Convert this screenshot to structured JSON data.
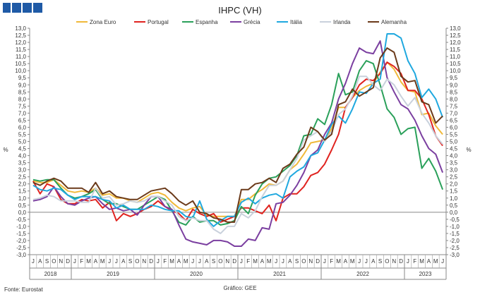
{
  "logo": {
    "color": "#1f5aa6"
  },
  "chart_data": {
    "type": "line",
    "title": "IHPC (VH)",
    "ylabel_left": "%",
    "ylabel_right": "%",
    "ylim": [
      -3.0,
      13.0
    ],
    "ytick_step": 0.5,
    "ytick_labels": [
      "13,0",
      "12,5",
      "12,0",
      "11,5",
      "11,0",
      "10,5",
      "10,0",
      "9,5",
      "9,0",
      "8,5",
      "8,0",
      "7,5",
      "7,0",
      "6,5",
      "6,0",
      "5,5",
      "5,0",
      "4,5",
      "4,0",
      "3,5",
      "3,0",
      "2,5",
      "2,0",
      "1,5",
      "1,0",
      "0,5",
      "0,0",
      "-0,5",
      "-1,0",
      "-1,5",
      "-2,0",
      "-2,5",
      "-3,0"
    ],
    "grid": false,
    "legend_position": "top",
    "source": "Fonte: Eurostat",
    "credit": "Gráfico: GEE",
    "x_months": [
      "J",
      "A",
      "S",
      "O",
      "N",
      "D",
      "J",
      "F",
      "M",
      "A",
      "M",
      "J",
      "J",
      "A",
      "S",
      "O",
      "N",
      "D",
      "J",
      "F",
      "M",
      "A",
      "M",
      "J",
      "J",
      "A",
      "S",
      "O",
      "N",
      "D",
      "J",
      "F",
      "M",
      "A",
      "M",
      "J",
      "J",
      "A",
      "S",
      "O",
      "N",
      "D",
      "J",
      "F",
      "M",
      "A",
      "M",
      "J",
      "J",
      "A",
      "S",
      "O",
      "N",
      "D",
      "J",
      "F",
      "M",
      "A",
      "M",
      "J"
    ],
    "years": [
      {
        "label": "2018",
        "start": 0,
        "end": 6
      },
      {
        "label": "2019",
        "start": 6,
        "end": 18
      },
      {
        "label": "2020",
        "start": 18,
        "end": 30
      },
      {
        "label": "2021",
        "start": 30,
        "end": 42
      },
      {
        "label": "2022",
        "start": 42,
        "end": 54
      },
      {
        "label": "2023",
        "start": 54,
        "end": 60
      }
    ],
    "series": [
      {
        "name": "Zona Euro",
        "color": "#f0b93a",
        "values": [
          2.2,
          2.1,
          2.1,
          2.3,
          1.9,
          1.5,
          1.4,
          1.5,
          1.4,
          1.7,
          1.2,
          1.3,
          1.0,
          1.0,
          0.8,
          0.7,
          1.0,
          1.3,
          1.4,
          1.2,
          0.7,
          0.3,
          0.1,
          0.3,
          0.4,
          -0.2,
          -0.3,
          -0.3,
          -0.3,
          -0.3,
          0.9,
          0.9,
          1.3,
          1.6,
          2.0,
          1.9,
          2.2,
          3.0,
          3.4,
          4.1,
          4.9,
          5.0,
          5.1,
          5.9,
          7.4,
          7.4,
          8.1,
          8.6,
          8.9,
          9.1,
          9.9,
          10.6,
          10.1,
          9.2,
          8.6,
          8.5,
          6.9,
          7.0,
          6.1,
          5.5
        ]
      },
      {
        "name": "Portugal",
        "color": "#e0231f",
        "values": [
          2.2,
          1.3,
          2.0,
          1.8,
          0.9,
          0.6,
          0.6,
          0.9,
          0.8,
          0.9,
          0.3,
          0.7,
          -0.6,
          -0.1,
          -0.3,
          -0.1,
          0.2,
          0.4,
          0.8,
          0.4,
          0.1,
          -0.1,
          -0.6,
          0.2,
          -0.1,
          -0.3,
          -0.1,
          -0.7,
          -0.5,
          -0.3,
          0.3,
          0.3,
          0.1,
          -0.1,
          0.5,
          -0.6,
          1.0,
          1.3,
          1.3,
          1.8,
          2.6,
          2.8,
          3.4,
          4.4,
          5.5,
          7.4,
          8.1,
          9.0,
          9.4,
          9.3,
          9.8,
          10.6,
          10.3,
          9.8,
          8.6,
          8.6,
          8.0,
          6.9,
          5.4,
          4.7
        ]
      },
      {
        "name": "Espanha",
        "color": "#2aa05a",
        "values": [
          2.3,
          2.2,
          2.3,
          2.3,
          1.7,
          1.2,
          1.0,
          1.1,
          1.3,
          1.6,
          0.9,
          0.6,
          0.6,
          0.4,
          0.2,
          0.2,
          0.5,
          0.8,
          1.1,
          0.9,
          0.1,
          -0.7,
          -0.9,
          -0.3,
          -0.7,
          -0.6,
          -0.6,
          -0.9,
          -0.8,
          -0.6,
          0.4,
          -0.1,
          1.2,
          2.0,
          2.4,
          2.5,
          2.9,
          3.3,
          4.0,
          5.4,
          5.5,
          6.6,
          6.2,
          7.6,
          9.8,
          8.3,
          8.5,
          10.0,
          10.7,
          10.5,
          9.0,
          7.3,
          6.7,
          5.5,
          5.9,
          6.0,
          3.1,
          3.8,
          2.9,
          1.6
        ]
      },
      {
        "name": "Grécia",
        "color": "#7b3fa0",
        "values": [
          0.8,
          0.9,
          1.1,
          1.8,
          1.1,
          0.6,
          0.5,
          0.8,
          1.0,
          1.1,
          0.6,
          0.2,
          0.3,
          0.1,
          0.2,
          -0.2,
          0.5,
          1.1,
          1.1,
          0.4,
          0.2,
          -0.9,
          -1.9,
          -2.1,
          -2.2,
          -2.3,
          -2.0,
          -2.0,
          -2.1,
          -2.4,
          -2.4,
          -1.9,
          -2.0,
          -1.1,
          -1.2,
          0.6,
          0.7,
          1.2,
          1.9,
          2.8,
          4.0,
          4.4,
          5.5,
          6.3,
          8.0,
          9.1,
          10.5,
          11.6,
          11.3,
          11.2,
          12.1,
          9.5,
          8.5,
          7.6,
          7.3,
          6.5,
          5.4,
          4.5,
          4.1,
          2.8
        ]
      },
      {
        "name": "Itália",
        "color": "#1fa8df",
        "values": [
          1.9,
          1.6,
          1.5,
          1.7,
          1.6,
          1.2,
          0.9,
          1.1,
          1.1,
          1.1,
          0.9,
          0.8,
          0.3,
          0.5,
          0.2,
          0.2,
          0.2,
          0.5,
          0.4,
          0.2,
          0.1,
          0.1,
          -0.3,
          -0.4,
          0.8,
          -0.5,
          -1.0,
          -0.6,
          -0.3,
          -0.3,
          0.7,
          1.0,
          0.6,
          1.0,
          1.2,
          1.3,
          1.0,
          2.5,
          2.9,
          3.2,
          4.0,
          4.2,
          5.1,
          6.2,
          6.8,
          6.3,
          7.3,
          8.5,
          8.4,
          9.1,
          9.4,
          12.6,
          12.6,
          12.3,
          10.7,
          9.8,
          8.1,
          8.7,
          8.0,
          6.7
        ]
      },
      {
        "name": "Irlanda",
        "color": "#c9d1dc",
        "values": [
          0.9,
          1.0,
          1.2,
          1.1,
          0.8,
          0.8,
          0.8,
          0.7,
          0.7,
          1.7,
          1.0,
          1.1,
          0.5,
          0.6,
          0.8,
          0.7,
          0.8,
          1.1,
          1.1,
          0.8,
          0.5,
          -0.3,
          -0.6,
          -0.4,
          -0.6,
          -0.6,
          -1.2,
          -1.5,
          -1.0,
          -1.0,
          -0.1,
          -0.4,
          0.1,
          1.1,
          1.9,
          1.9,
          2.2,
          3.0,
          3.8,
          5.1,
          5.4,
          5.7,
          5.0,
          5.7,
          6.9,
          7.3,
          8.2,
          9.6,
          9.6,
          9.0,
          8.6,
          9.4,
          9.0,
          8.2,
          7.5,
          8.1,
          7.0,
          6.3,
          5.4,
          4.8
        ]
      },
      {
        "name": "Alemanha",
        "color": "#6b3a1a",
        "values": [
          2.1,
          1.9,
          2.2,
          2.4,
          2.2,
          1.7,
          1.7,
          1.7,
          1.4,
          2.1,
          1.3,
          1.5,
          1.1,
          1.0,
          0.9,
          0.9,
          1.2,
          1.5,
          1.6,
          1.7,
          1.3,
          0.8,
          0.5,
          0.8,
          0.0,
          -0.1,
          -0.4,
          -0.5,
          -0.7,
          -0.7,
          1.6,
          1.6,
          2.0,
          2.1,
          2.4,
          2.1,
          3.1,
          3.4,
          4.1,
          4.6,
          6.0,
          5.7,
          5.1,
          5.5,
          7.6,
          7.8,
          8.7,
          8.2,
          8.5,
          8.8,
          10.9,
          11.6,
          11.3,
          9.6,
          9.2,
          9.3,
          7.8,
          7.6,
          6.3,
          6.8
        ]
      }
    ]
  }
}
